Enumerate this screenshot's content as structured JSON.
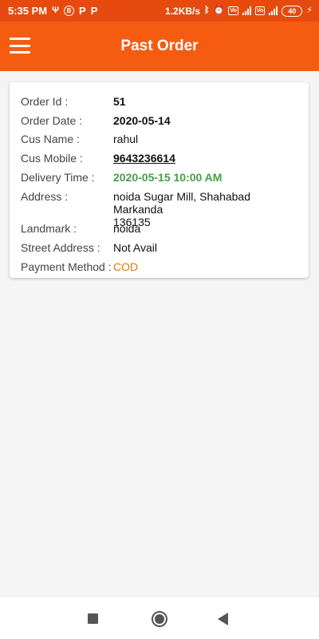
{
  "status_bar": {
    "time": "5:35 PM",
    "network_speed": "1.2KB/s",
    "battery_level": "40",
    "icons": [
      "usb-icon",
      "b-circle-icon",
      "p-app-icon",
      "p-app-icon",
      "bluetooth-icon",
      "alarm-icon",
      "volte-icon",
      "4g-signal-icon",
      "volte-icon",
      "signal-icon",
      "battery-icon",
      "charging-icon"
    ]
  },
  "app_bar": {
    "title": "Past Order",
    "menu_icon": "hamburger-menu-icon",
    "background": "#f55c12"
  },
  "order": {
    "order_id_label": "Order Id :",
    "order_id": "51",
    "order_date_label": "Order Date :",
    "order_date": "2020-05-14",
    "cus_name_label": "Cus Name :",
    "cus_name": "rahul",
    "cus_mobile_label": "Cus Mobile :",
    "cus_mobile": "9643236614",
    "delivery_time_label": "Delivery Time :",
    "delivery_time": "2020-05-15 10:00 AM",
    "address_label": "Address :",
    "address_line1": "noida Sugar Mill, Shahabad Markanda",
    "address_line2": "136135",
    "landmark_label": "Landmark :",
    "landmark": "noida",
    "street_address_label": "Street Address :",
    "street_address": "Not Avail",
    "payment_method_label": "Payment Method :",
    "payment_method": "COD"
  },
  "colors": {
    "delivery_time": "#43a047",
    "payment_method": "#e47911"
  },
  "nav_bar": {
    "icons": [
      "recent-apps-icon",
      "home-icon",
      "back-icon"
    ]
  }
}
